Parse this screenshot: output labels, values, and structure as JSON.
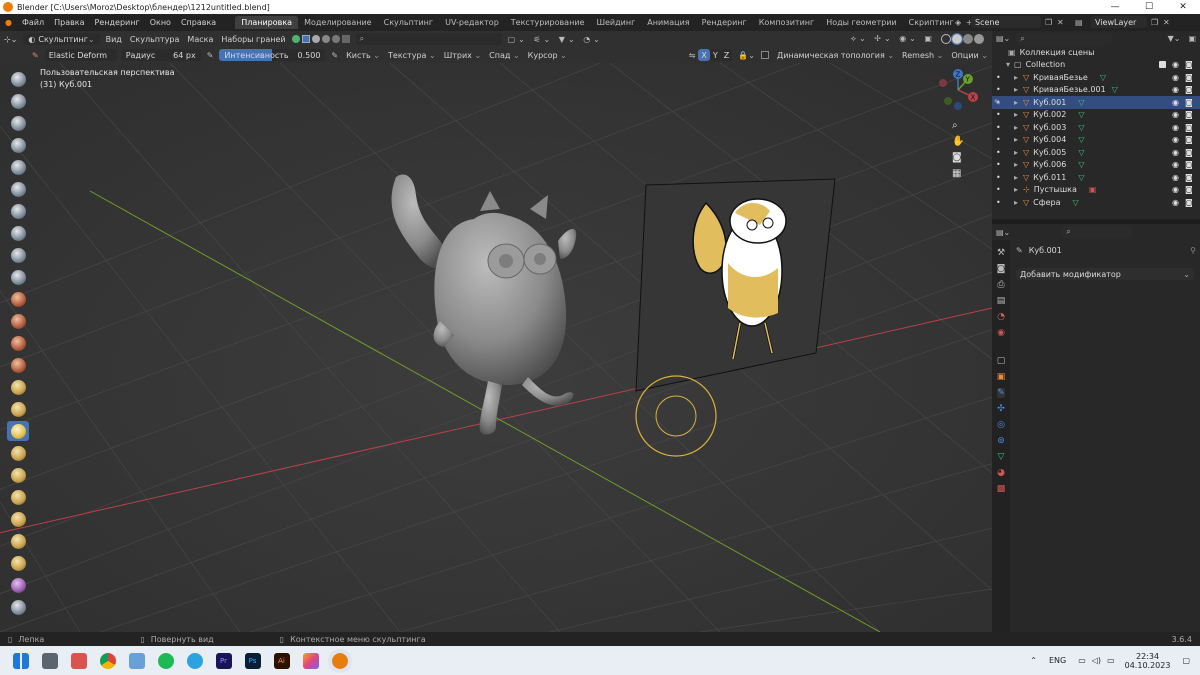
{
  "titlebar": {
    "title": "Blender [C:\\Users\\Moroz\\Desktop\\блендер\\1212untitled.blend]",
    "minimize": "—",
    "maximize": "☐",
    "close": "✕"
  },
  "menu": [
    "Файл",
    "Правка",
    "Рендеринг",
    "Окно",
    "Справка"
  ],
  "workspaces": [
    "Планировка",
    "Моделирование",
    "Скульптинг",
    "UV-редактор",
    "Текстурирование",
    "Шейдинг",
    "Анимация",
    "Рендеринг",
    "Композитинг",
    "Ноды геометрии",
    "Скриптинг"
  ],
  "add_workspace": "+",
  "scene": {
    "name": "Scene",
    "view_layer": "ViewLayer"
  },
  "header": {
    "mode": "Скульптинг",
    "menus": [
      "Вид",
      "Скульптура",
      "Маска",
      "Наборы граней"
    ]
  },
  "tool_settings": {
    "brush": "Elastic Deform",
    "radius_label": "Радиус",
    "radius_value": "64 px",
    "strength_label": "Интенсивность",
    "strength_value": "0.500",
    "brush_menu": "Кисть",
    "texture_menu": "Текстура",
    "stroke_menu": "Штрих",
    "falloff_menu": "Спад",
    "cursor_menu": "Курсор",
    "axes": [
      "X",
      "Y",
      "Z"
    ],
    "dyntopo": "Динамическая топология",
    "remesh": "Remesh",
    "options": "Опции"
  },
  "viewport": {
    "perspective": "Пользовательская перспектива",
    "object_info": "(31) Куб.001"
  },
  "gizmo": {
    "x": "X",
    "y": "Y",
    "z": "Z"
  },
  "outliner": {
    "collection_root": "Коллекция сцены",
    "collection": "Collection",
    "items": [
      "КриваяБезье",
      "КриваяБезье.001",
      "Куб.001",
      "Куб.002",
      "Куб.003",
      "Куб.004",
      "Куб.005",
      "Куб.006",
      "Куб.011",
      "Пустышка",
      "Сфера"
    ],
    "selected_index": 2
  },
  "properties": {
    "object": "Куб.001",
    "add_modifier": "Добавить модификатор"
  },
  "statusbar": {
    "left": "Лепка",
    "middle": "Повернуть вид",
    "right": "Контекстное меню скульптинга",
    "version": "3.6.4"
  },
  "taskbar": {
    "lang": "ENG",
    "time": "22:34",
    "date": "04.10.2023"
  },
  "colors": {
    "accent": "#4772b3",
    "selection": "#334d80",
    "brush_ring": "#d9b13b",
    "x_axis": "#b8414a",
    "y_axis": "#6a9e2a",
    "z_axis": "#3f76c4"
  }
}
